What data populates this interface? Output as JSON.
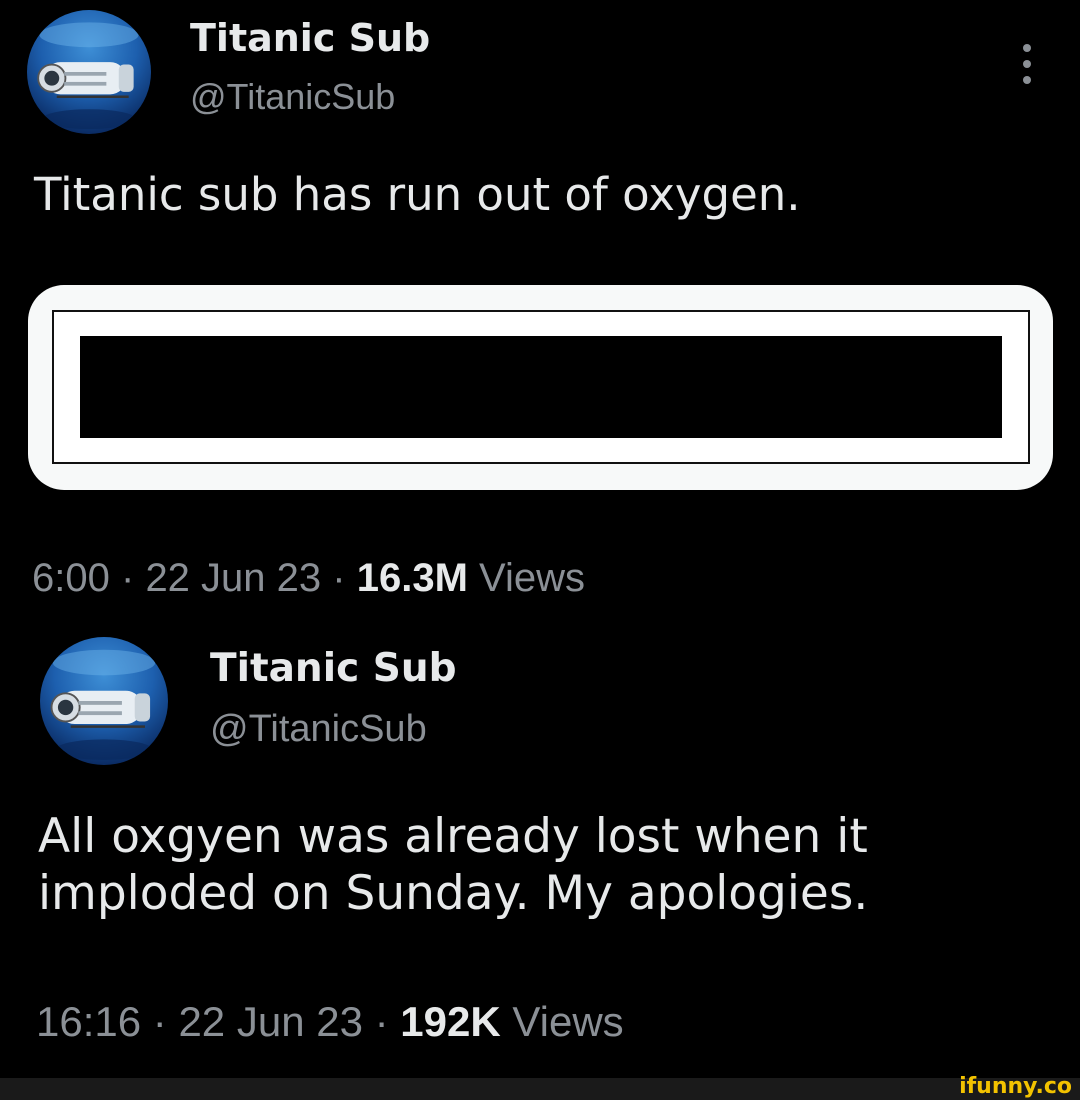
{
  "tweets": [
    {
      "display_name": "Titanic Sub",
      "handle": "@TitanicSub",
      "text": "Titanic sub has run out of oxygen.",
      "time": "6:00",
      "date": "22 Jun 23",
      "views_count": "16.3M",
      "views_label": "Views"
    },
    {
      "display_name": "Titanic Sub",
      "handle": "@TitanicSub",
      "text": "All oxgyen was already lost when it imploded on Sunday. My apologies.",
      "time": "16:16",
      "date": "22 Jun 23",
      "views_count": "192K",
      "views_label": "Views"
    }
  ],
  "separator": "·",
  "watermark": "ifunny.co",
  "icons": {
    "more": "more-vertical-icon",
    "avatar": "submarine-avatar-icon"
  },
  "colors": {
    "background": "#000000",
    "primary_text": "#e7e9ea",
    "secondary_text": "#8b9096",
    "watermark": "#f2c200"
  }
}
